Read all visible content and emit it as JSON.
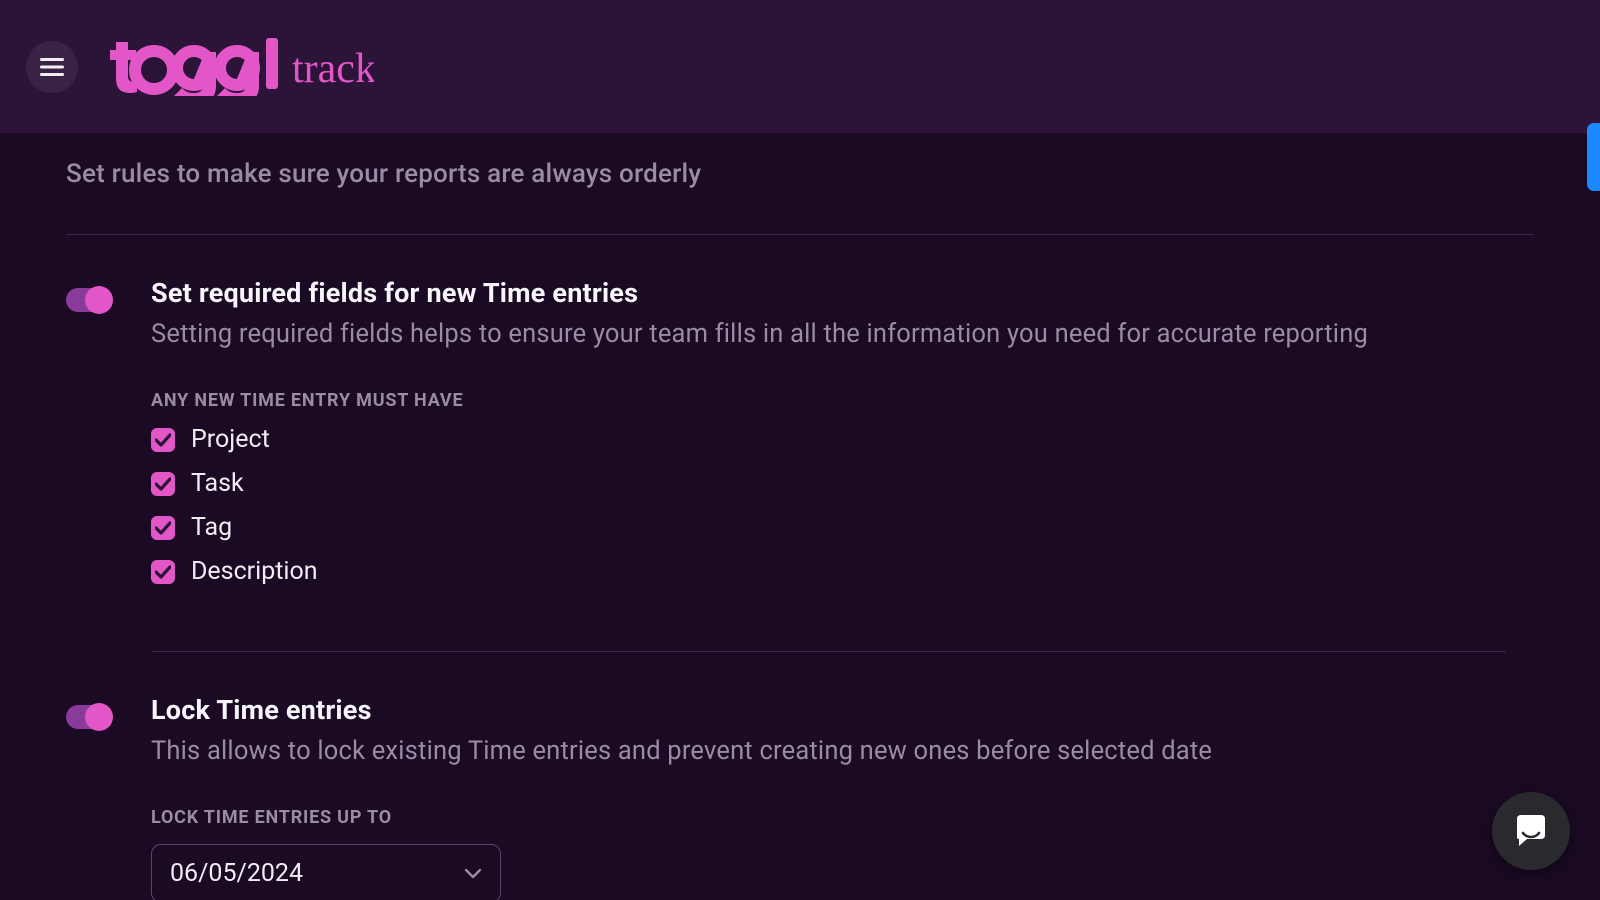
{
  "brand": {
    "name": "toggl",
    "product": "track",
    "color": "#e256c7"
  },
  "page": {
    "subtitle": "Set rules to make sure your reports are always orderly"
  },
  "required_fields": {
    "enabled": true,
    "title": "Set required fields for new Time entries",
    "description": "Setting required fields helps to ensure your team fills in all the information you need for accurate reporting",
    "caption": "ANY NEW TIME ENTRY MUST HAVE",
    "items": [
      {
        "label": "Project",
        "checked": true
      },
      {
        "label": "Task",
        "checked": true
      },
      {
        "label": "Tag",
        "checked": true
      },
      {
        "label": "Description",
        "checked": true
      }
    ]
  },
  "lock_entries": {
    "enabled": true,
    "title": "Lock Time entries",
    "description": "This allows to lock existing Time entries and prevent creating new ones before selected date",
    "caption": "LOCK TIME ENTRIES UP TO",
    "date": "06/05/2024"
  }
}
